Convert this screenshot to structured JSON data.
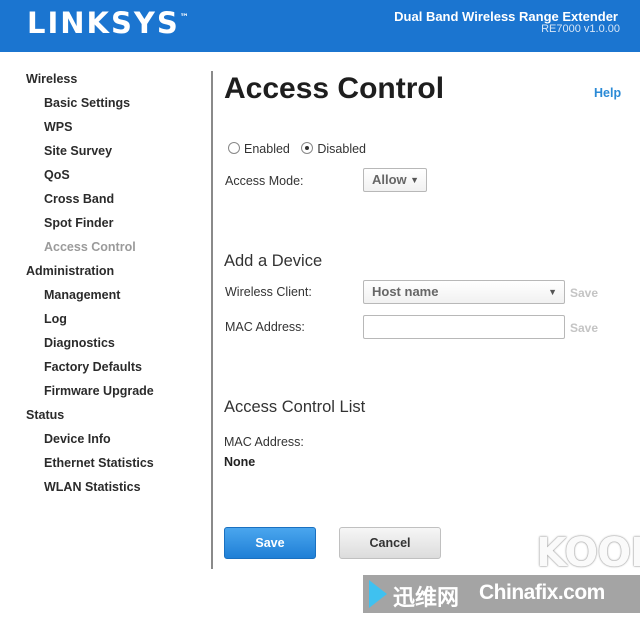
{
  "header": {
    "logo_text": "LINKSYS",
    "logo_mark": "™",
    "product_name": "Dual Band Wireless Range Extender",
    "product_version": "RE7000 v1.0.00",
    "brand_color": "#1b75d0"
  },
  "sidebar": {
    "groups": [
      {
        "label": "Wireless",
        "items": [
          "Basic Settings",
          "WPS",
          "Site Survey",
          "QoS",
          "Cross Band",
          "Spot Finder",
          "Access Control"
        ]
      },
      {
        "label": "Administration",
        "items": [
          "Management",
          "Log",
          "Diagnostics",
          "Factory Defaults",
          "Firmware Upgrade"
        ]
      },
      {
        "label": "Status",
        "items": [
          "Device Info",
          "Ethernet Statistics",
          "WLAN Statistics"
        ]
      }
    ],
    "active_item": "Access Control"
  },
  "main": {
    "title": "Access Control",
    "help_label": "Help",
    "status": {
      "enabled_label": "Enabled",
      "disabled_label": "Disabled",
      "selected": "Disabled"
    },
    "access_mode": {
      "label": "Access Mode:",
      "value": "Allow"
    },
    "add_device": {
      "title": "Add a Device",
      "wireless_client_label": "Wireless Client:",
      "wireless_client_value": "Host name",
      "mac_address_label": "MAC Address:",
      "mac_address_value": "",
      "save_label": "Save"
    },
    "access_list": {
      "title": "Access Control List",
      "mac_address_label": "MAC Address:",
      "value": "None"
    },
    "buttons": {
      "save": "Save",
      "cancel": "Cancel"
    }
  },
  "watermark": {
    "kook": "KOOK",
    "cn_text": "迅维网",
    "site": "Chinafix.com"
  }
}
